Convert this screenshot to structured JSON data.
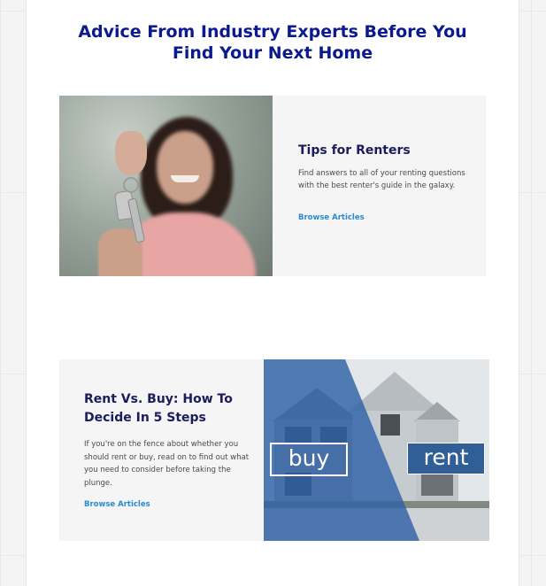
{
  "section": {
    "heading_line1": "Advice From Industry Experts Before You",
    "heading_line2": "Find Your Next Home"
  },
  "tips_card": {
    "title": "Tips for Renters",
    "body": "Find answers to all of your renting questions with the best renter's guide in the galaxy.",
    "link": "Browse Articles"
  },
  "rent_buy_card": {
    "title": "Rent Vs. Buy: How To Decide In 5 Steps",
    "body": "If you're on the fence about whether you should rent or buy, read on to find out what you need to consider before taking the plunge.",
    "link": "Browse Articles",
    "image_label_buy": "buy",
    "image_label_rent": "rent"
  },
  "colors": {
    "heading": "#0b1a8c",
    "card_title": "#1b1c5c",
    "link": "#2a8ad2",
    "overlay_blue": "#3d6ea8"
  }
}
